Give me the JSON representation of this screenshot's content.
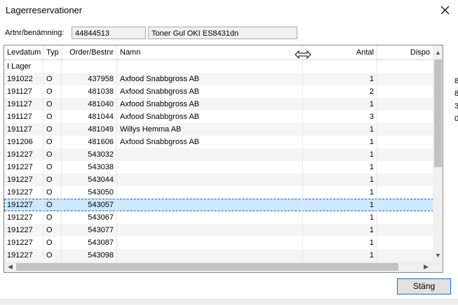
{
  "window": {
    "title": "Lagerreservationer"
  },
  "article": {
    "label": "Artnr/benämning:",
    "number": "44844513",
    "name": "Toner Gul OKI ES8431dn"
  },
  "table": {
    "columns": [
      "Levdatum",
      "Typ",
      "Order/Bestnr",
      "Namn",
      "Antal",
      "Dispo"
    ],
    "rows": [
      {
        "levdatum": "I Lager",
        "typ": "",
        "order": "",
        "namn": "",
        "antal": ""
      },
      {
        "levdatum": "191022",
        "typ": "O",
        "order": "437958",
        "namn": "Axfood Snabbgross AB",
        "antal": "1"
      },
      {
        "levdatum": "191127",
        "typ": "O",
        "order": "481038",
        "namn": "Axfood Snabbgross AB",
        "antal": "2"
      },
      {
        "levdatum": "191127",
        "typ": "O",
        "order": "481040",
        "namn": "Axfood Snabbgross AB",
        "antal": "1"
      },
      {
        "levdatum": "191127",
        "typ": "O",
        "order": "481044",
        "namn": "Axfood Snabbgross AB",
        "antal": "3"
      },
      {
        "levdatum": "191127",
        "typ": "O",
        "order": "481049",
        "namn": "Willys Hemma AB",
        "antal": "1"
      },
      {
        "levdatum": "191206",
        "typ": "O",
        "order": "481606",
        "namn": "Axfood Snabbgross AB",
        "antal": "1"
      },
      {
        "levdatum": "191227",
        "typ": "O",
        "order": "543032",
        "namn": "",
        "antal": "1"
      },
      {
        "levdatum": "191227",
        "typ": "O",
        "order": "543038",
        "namn": "",
        "antal": "1"
      },
      {
        "levdatum": "191227",
        "typ": "O",
        "order": "543044",
        "namn": "",
        "antal": "1"
      },
      {
        "levdatum": "191227",
        "typ": "O",
        "order": "543050",
        "namn": "",
        "antal": "1"
      },
      {
        "levdatum": "191227",
        "typ": "O",
        "order": "543057",
        "namn": "",
        "antal": "1"
      },
      {
        "levdatum": "191227",
        "typ": "O",
        "order": "543067",
        "namn": "",
        "antal": "1"
      },
      {
        "levdatum": "191227",
        "typ": "O",
        "order": "543077",
        "namn": "",
        "antal": "1"
      },
      {
        "levdatum": "191227",
        "typ": "O",
        "order": "543087",
        "namn": "",
        "antal": "1"
      },
      {
        "levdatum": "191227",
        "typ": "O",
        "order": "543098",
        "namn": "",
        "antal": "1"
      }
    ],
    "selected_row": 11
  },
  "buttons": {
    "close_label": "Stäng"
  },
  "edge_digits": [
    "8",
    "8",
    "3",
    "0"
  ],
  "colors": {
    "selection": "#cde8ff",
    "button_border": "#0078d7",
    "row_alt": "#f5f5f5"
  }
}
